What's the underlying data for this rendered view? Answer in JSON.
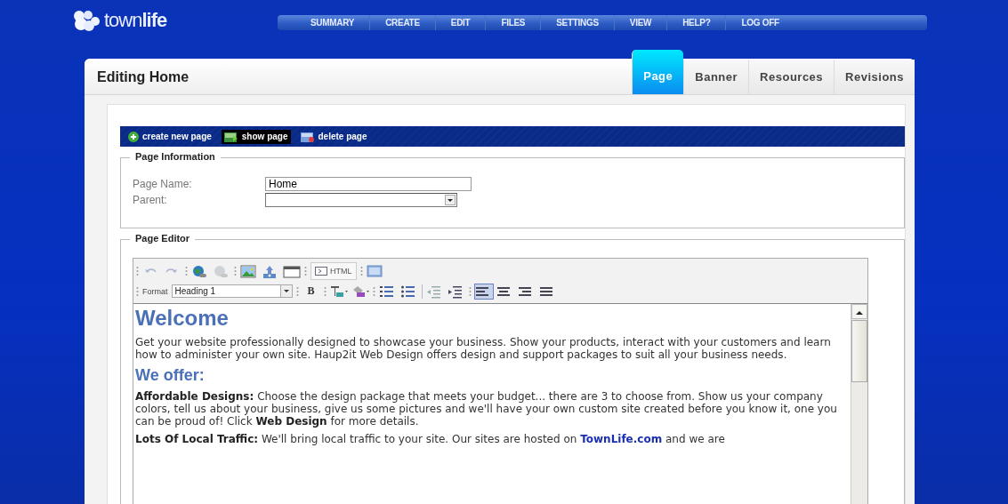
{
  "logo": {
    "text": "town**life**"
  },
  "nav": [
    {
      "label": "SUMMARY"
    },
    {
      "label": "CREATE"
    },
    {
      "label": "EDIT"
    },
    {
      "label": "FILES"
    },
    {
      "label": "SETTINGS"
    },
    {
      "label": "VIEW"
    },
    {
      "label": "HELP?"
    },
    {
      "label": "LOG OFF"
    }
  ],
  "card": {
    "title": "Editing Home",
    "tabs": [
      {
        "label": "Page",
        "selected": true
      },
      {
        "label": "Banner",
        "selected": false
      },
      {
        "label": "Resources",
        "selected": false
      },
      {
        "label": "Revisions",
        "selected": false
      }
    ]
  },
  "actions": [
    {
      "kind": "create",
      "label": "create new page",
      "selected": false
    },
    {
      "kind": "show",
      "label": "show page",
      "selected": true
    },
    {
      "kind": "delete",
      "label": "delete page",
      "selected": false
    }
  ],
  "page_information": {
    "legend": "Page Information",
    "page_name": {
      "label": "Page Name:",
      "value": "Home"
    },
    "parent": {
      "label": "Parent:"
    }
  },
  "page_editor": {
    "legend": "Page Editor",
    "toolbar_row_1": [
      {
        "kind": "undo",
        "disabled": true
      },
      {
        "kind": "redo",
        "disabled": true
      },
      {
        "kind": "sep"
      },
      {
        "kind": "link",
        "disabled": false
      },
      {
        "kind": "unlink",
        "disabled": true
      },
      {
        "kind": "sep"
      },
      {
        "kind": "image",
        "disabled": false
      },
      {
        "kind": "upload",
        "disabled": false
      },
      {
        "kind": "window",
        "disabled": false
      },
      {
        "kind": "sep"
      },
      {
        "kind": "html",
        "label": "HTML",
        "disabled": false
      },
      {
        "kind": "sep"
      },
      {
        "kind": "preview",
        "disabled": false
      }
    ],
    "format": {
      "label": "Format",
      "value": "Heading 1"
    },
    "toolbar_row_2": [
      {
        "kind": "sep"
      },
      {
        "kind": "bold",
        "label": "B",
        "selected": false
      },
      {
        "kind": "sep"
      },
      {
        "kind": "textcolor",
        "selected": false
      },
      {
        "kind": "bgcolor",
        "selected": false
      },
      {
        "kind": "sep"
      },
      {
        "kind": "ol",
        "selected": false
      },
      {
        "kind": "ul",
        "selected": false
      },
      {
        "kind": "bar"
      },
      {
        "kind": "outdent",
        "selected": false
      },
      {
        "kind": "indent",
        "selected": false
      },
      {
        "kind": "sep"
      },
      {
        "kind": "alignleft",
        "selected": true
      },
      {
        "kind": "aligncenter",
        "selected": false
      },
      {
        "kind": "alignright",
        "selected": false
      },
      {
        "kind": "justify",
        "selected": false
      }
    ],
    "content": [
      {
        "kind": "heading1",
        "text": "Welcome"
      },
      {
        "kind": "paragraph",
        "parts": [
          {
            "kind": "plain",
            "text": "Get your website professionally designed to showcase your business. Show your products, interact with your customers and learn how to administer your own site. Haup2it Web Design offers design and support packages to suit all your business needs."
          }
        ]
      },
      {
        "kind": "heading2",
        "text": "We offer:"
      },
      {
        "kind": "paragraph",
        "parts": [
          {
            "kind": "bold",
            "text": "Affordable Designs:"
          },
          {
            "kind": "plain",
            "text": "  Choose the design package that meets your budget... there are 3 to choose from. Show us your company colors, tell us about your business, give us some pictures and we'll have  your own custom site created before you know it, one you can be proud of! Click "
          },
          {
            "kind": "bold",
            "text": "Web Design"
          },
          {
            "kind": "plain",
            "text": " for more details."
          }
        ]
      },
      {
        "kind": "paragraph",
        "parts": [
          {
            "kind": "bold",
            "text": "Lots Of Local Traffic:"
          },
          {
            "kind": "plain",
            "text": " We'll bring local traffic to your site. Our sites are hosted on "
          },
          {
            "kind": "link",
            "text": "TownLife.com"
          },
          {
            "kind": "plain",
            "text": " and we are"
          }
        ]
      }
    ]
  }
}
